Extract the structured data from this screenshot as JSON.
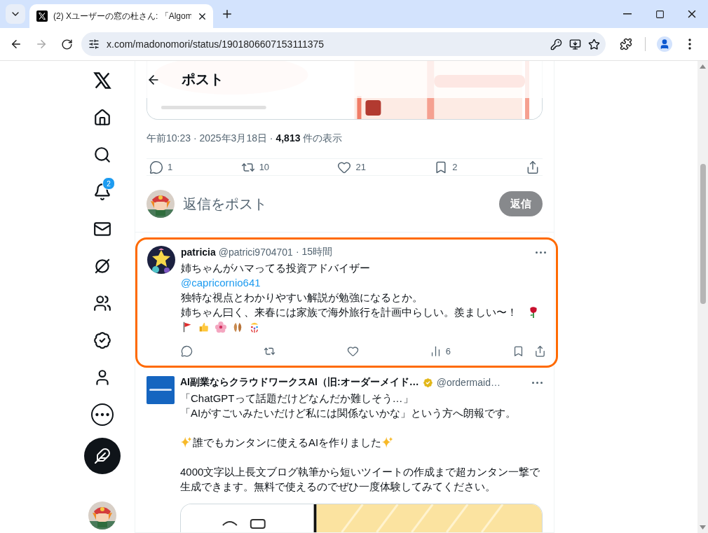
{
  "browser": {
    "tab": {
      "title": "(2) Xユーザーの窓の杜さん: 「Algom",
      "selected": true
    },
    "url": "x.com/madonomori/status/1901806607153111375",
    "forward_disabled": true
  },
  "nav": {
    "notification_badge": "2"
  },
  "header": {
    "title": "ポスト"
  },
  "post": {
    "meta": "午前10:23 · 2025年3月18日 · **4,813** 件の表示",
    "actions": [
      {
        "kind": "reply",
        "count": "1"
      },
      {
        "kind": "repost",
        "count": "10"
      },
      {
        "kind": "like",
        "count": "21"
      },
      {
        "kind": "bookmark",
        "count": "2"
      },
      {
        "kind": "share"
      }
    ]
  },
  "composer": {
    "placeholder": "返信をポスト",
    "button": {
      "label": "返信",
      "disabled": true
    }
  },
  "replies": [
    {
      "highlighted": true,
      "verified": false,
      "name": "patricia",
      "handle": "@patrici9704701",
      "time": "· 15時間",
      "lines": [
        {
          "kind": "text",
          "text": "姉ちゃんがハマってる投資アドバイザー"
        },
        {
          "kind": "mention",
          "text": "@capricornio641"
        },
        {
          "kind": "text",
          "text": "独特な視点とわかりやすい解説が勉強になるとか。"
        },
        {
          "kind": "text_rose",
          "text": "姉ちゃん曰く、来春には家族で海外旅行を計画中らしい。羨ましい〜！"
        },
        {
          "kind": "emoji_row"
        }
      ],
      "actions": [
        {
          "kind": "reply"
        },
        {
          "kind": "repost"
        },
        {
          "kind": "like"
        },
        {
          "kind": "views",
          "count": "6"
        },
        {
          "kind": "bookmark"
        },
        {
          "kind": "share"
        }
      ]
    },
    {
      "highlighted": false,
      "verified": true,
      "name": "AI副業ならクラウドワークスAI（旧:オーダーメイド…",
      "handle": "@ordermaid…",
      "lines": [
        {
          "kind": "text",
          "text": "「ChatGPTって話題だけどなんだか難しそう…」"
        },
        {
          "kind": "text",
          "text": "「AIがすごいみたいだけど私には関係ないかな」という方へ朗報です。"
        },
        {
          "kind": "blank"
        },
        {
          "kind": "sparkle",
          "text": "誰でもカンタンに使えるAIを作りました"
        },
        {
          "kind": "blank"
        },
        {
          "kind": "text",
          "text": "4000文字以上長文ブログ執筆から短いツイートの作成まで超カンタン一撃で生成できます。無料で使えるのでぜひ一度体験してみてください。"
        }
      ]
    }
  ]
}
